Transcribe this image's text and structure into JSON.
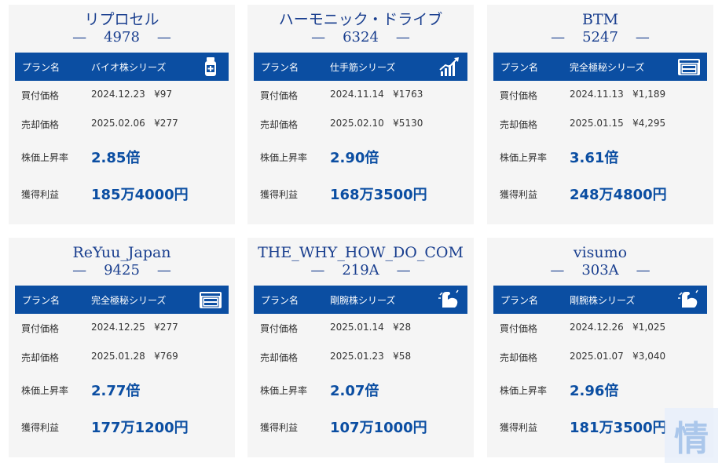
{
  "cards": [
    {
      "name": "リプロセル",
      "code": "4978",
      "plan_label": "プラン名",
      "series": "バイオ株シリーズ",
      "icon": "medicine-bottle-icon",
      "buy_label": "買付価格",
      "buy_date": "2024.12.23",
      "buy_price": "¥97",
      "sell_label": "売却価格",
      "sell_date": "2025.02.06",
      "sell_price": "¥277",
      "rate_label": "株価上昇率",
      "rate": "2.85倍",
      "profit_label": "獲得利益",
      "profit": "185万4000円"
    },
    {
      "name": "ハーモニック・ドライブ",
      "code": "6324",
      "plan_label": "プラン名",
      "series": "仕手筋シリーズ",
      "icon": "rising-chart-icon",
      "buy_label": "買付価格",
      "buy_date": "2024.11.14",
      "buy_price": "¥1763",
      "sell_label": "売却価格",
      "sell_date": "2025.02.10",
      "sell_price": "¥5130",
      "rate_label": "株価上昇率",
      "rate": "2.90倍",
      "profit_label": "獲得利益",
      "profit": "168万3500円"
    },
    {
      "name": "BTM",
      "code": "5247",
      "plan_label": "プラン名",
      "series": "完全極秘シリーズ",
      "icon": "top-secret-icon",
      "buy_label": "買付価格",
      "buy_date": "2024.11.13",
      "buy_price": "¥1,189",
      "sell_label": "売却価格",
      "sell_date": "2025.01.15",
      "sell_price": "¥4,295",
      "rate_label": "株価上昇率",
      "rate": "3.61倍",
      "profit_label": "獲得利益",
      "profit": "248万4800円"
    },
    {
      "name": "ReYuu_Japan",
      "code": "9425",
      "plan_label": "プラン名",
      "series": "完全極秘シリーズ",
      "icon": "top-secret-icon",
      "buy_label": "買付価格",
      "buy_date": "2024.12.25",
      "buy_price": "¥277",
      "sell_label": "売却価格",
      "sell_date": "2025.01.28",
      "sell_price": "¥769",
      "rate_label": "株価上昇率",
      "rate": "2.77倍",
      "profit_label": "獲得利益",
      "profit": "177万1200円"
    },
    {
      "name": "THE_WHY_HOW_DO_COM",
      "code": "219A",
      "plan_label": "プラン名",
      "series": "剛腕株シリーズ",
      "icon": "flexed-arm-icon",
      "buy_label": "買付価格",
      "buy_date": "2025.01.14",
      "buy_price": "¥28",
      "sell_label": "売却価格",
      "sell_date": "2025.01.23",
      "sell_price": "¥58",
      "rate_label": "株価上昇率",
      "rate": "2.07倍",
      "profit_label": "獲得利益",
      "profit": "107万1000円"
    },
    {
      "name": "visumo",
      "code": "303A",
      "plan_label": "プラン名",
      "series": "剛腕株シリーズ",
      "icon": "flexed-arm-icon",
      "buy_label": "買付価格",
      "buy_date": "2024.12.26",
      "buy_price": "¥1,025",
      "sell_label": "売却価格",
      "sell_date": "2025.01.07",
      "sell_price": "¥3,040",
      "rate_label": "株価上昇率",
      "rate": "2.96倍",
      "profit_label": "獲得利益",
      "profit": "181万3500円"
    }
  ],
  "badge": {
    "text": "情"
  },
  "colors": {
    "accent": "#0b4ea2",
    "title": "#1a3f8f",
    "card_bg": "#f5f5f5"
  }
}
